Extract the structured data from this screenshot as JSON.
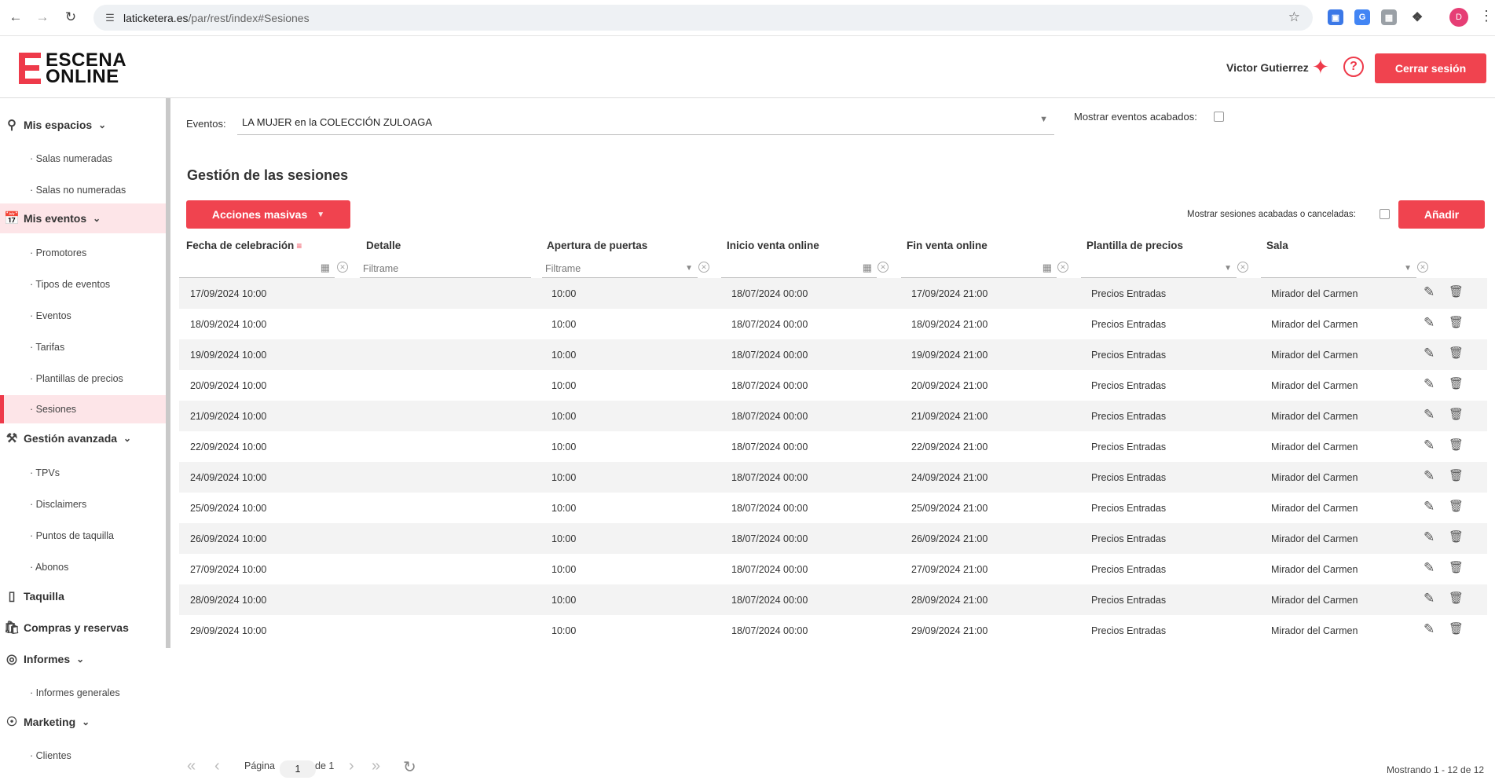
{
  "browser": {
    "url_host": "laticketera.es",
    "url_path": "/par/rest/index#Sesiones",
    "profile_initial": "D"
  },
  "header": {
    "logo_line1": "ESCENA",
    "logo_line2": "ONLINE",
    "user_name": "Victor Gutierrez",
    "logout_label": "Cerrar sesión",
    "accent_color": "#f0434f"
  },
  "sidebar": {
    "sections": [
      {
        "label": "Mis espacios",
        "items": [
          "· Salas numeradas",
          "· Salas no numeradas"
        ]
      },
      {
        "label": "Mis eventos",
        "items": [
          "· Promotores",
          "· Tipos de eventos",
          "· Eventos",
          "· Tarifas",
          "· Plantillas de precios",
          "· Sesiones"
        ]
      },
      {
        "label": "Gestión avanzada",
        "items": [
          "· TPVs",
          "· Disclaimers",
          "· Puntos de taquilla",
          "· Abonos"
        ]
      },
      {
        "label": "Taquilla"
      },
      {
        "label": "Compras y reservas"
      },
      {
        "label": "Informes",
        "items": [
          "· Informes generales"
        ]
      },
      {
        "label": "Marketing",
        "items": [
          "· Clientes"
        ]
      }
    ]
  },
  "filters": {
    "events_label": "Eventos:",
    "events_value": "LA MUJER en la COLECCIÓN ZULOAGA",
    "show_finished_label": "Mostrar eventos acabados:"
  },
  "main": {
    "title": "Gestión de las sesiones",
    "mass_actions_label": "Acciones masivas",
    "show_cancelled_label": "Mostrar sesiones acabadas o canceladas:",
    "add_label": "Añadir"
  },
  "table": {
    "columns": [
      "Fecha de celebración",
      "Detalle",
      "Apertura de puertas",
      "Inicio venta online",
      "Fin venta online",
      "Plantilla de precios",
      "Sala"
    ],
    "filter_placeholder": "Filtrame",
    "rows": [
      [
        "17/09/2024 10:00",
        "",
        "10:00",
        "18/07/2024 00:00",
        "17/09/2024 21:00",
        "Precios Entradas",
        "Mirador del Carmen"
      ],
      [
        "18/09/2024 10:00",
        "",
        "10:00",
        "18/07/2024 00:00",
        "18/09/2024 21:00",
        "Precios Entradas",
        "Mirador del Carmen"
      ],
      [
        "19/09/2024 10:00",
        "",
        "10:00",
        "18/07/2024 00:00",
        "19/09/2024 21:00",
        "Precios Entradas",
        "Mirador del Carmen"
      ],
      [
        "20/09/2024 10:00",
        "",
        "10:00",
        "18/07/2024 00:00",
        "20/09/2024 21:00",
        "Precios Entradas",
        "Mirador del Carmen"
      ],
      [
        "21/09/2024 10:00",
        "",
        "10:00",
        "18/07/2024 00:00",
        "21/09/2024 21:00",
        "Precios Entradas",
        "Mirador del Carmen"
      ],
      [
        "22/09/2024 10:00",
        "",
        "10:00",
        "18/07/2024 00:00",
        "22/09/2024 21:00",
        "Precios Entradas",
        "Mirador del Carmen"
      ],
      [
        "24/09/2024 10:00",
        "",
        "10:00",
        "18/07/2024 00:00",
        "24/09/2024 21:00",
        "Precios Entradas",
        "Mirador del Carmen"
      ],
      [
        "25/09/2024 10:00",
        "",
        "10:00",
        "18/07/2024 00:00",
        "25/09/2024 21:00",
        "Precios Entradas",
        "Mirador del Carmen"
      ],
      [
        "26/09/2024 10:00",
        "",
        "10:00",
        "18/07/2024 00:00",
        "26/09/2024 21:00",
        "Precios Entradas",
        "Mirador del Carmen"
      ],
      [
        "27/09/2024 10:00",
        "",
        "10:00",
        "18/07/2024 00:00",
        "27/09/2024 21:00",
        "Precios Entradas",
        "Mirador del Carmen"
      ],
      [
        "28/09/2024 10:00",
        "",
        "10:00",
        "18/07/2024 00:00",
        "28/09/2024 21:00",
        "Precios Entradas",
        "Mirador del Carmen"
      ],
      [
        "29/09/2024 10:00",
        "",
        "10:00",
        "18/07/2024 00:00",
        "29/09/2024 21:00",
        "Precios Entradas",
        "Mirador del Carmen"
      ]
    ]
  },
  "pager": {
    "page_label": "Página",
    "page_value": "1",
    "of_label": "de 1",
    "showing": "Mostrando 1 - 12 de 12"
  }
}
